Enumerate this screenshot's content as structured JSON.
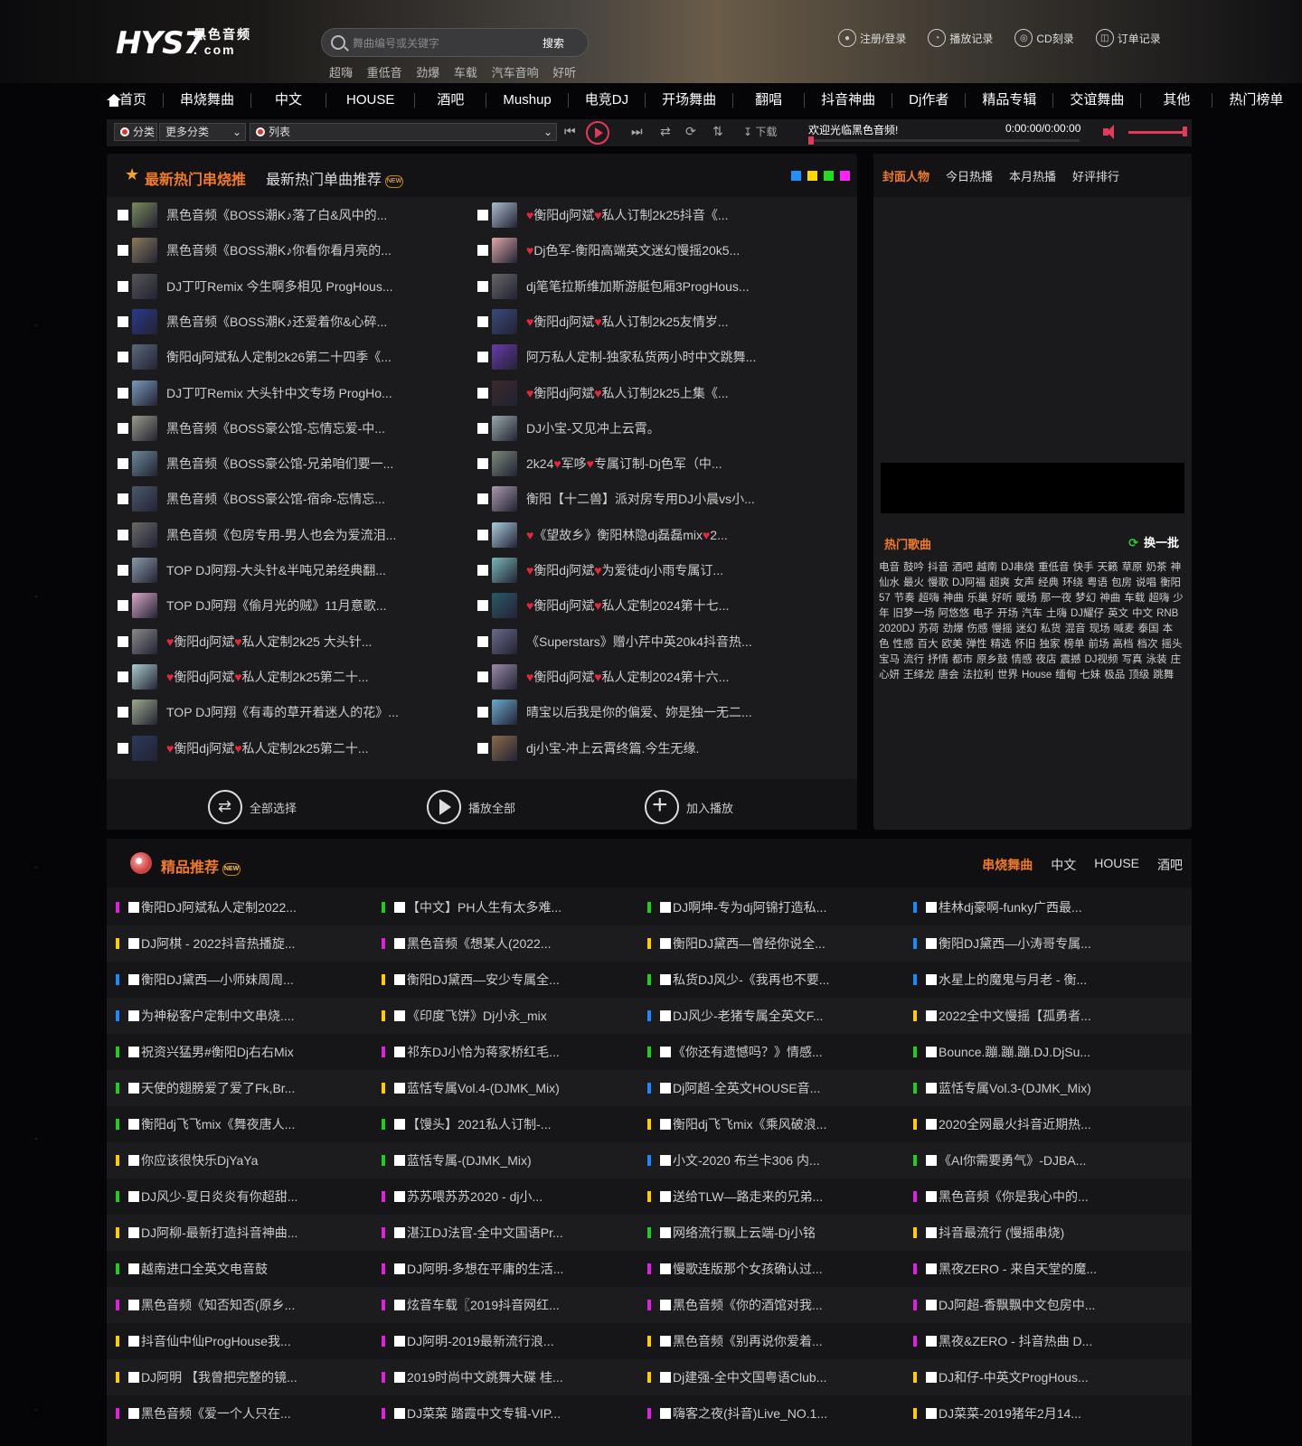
{
  "header": {
    "logo": "HYS7",
    "logo_sub1": "黑色音频",
    "logo_sub2": ". com",
    "search_placeholder": "舞曲编号或关键字",
    "search_button": "搜索",
    "hot_tags": [
      "超嗨",
      "重低音",
      "劲爆",
      "车载",
      "汽车音响",
      "好听"
    ],
    "links": [
      {
        "label": "注册/登录",
        "icon": "user-icon"
      },
      {
        "label": "播放记录",
        "icon": "clock-icon"
      },
      {
        "label": "CD刻录",
        "icon": "disc-icon"
      },
      {
        "label": "订单记录",
        "icon": "order-icon"
      }
    ]
  },
  "nav": {
    "items": [
      "首页",
      "串烧舞曲",
      "中文",
      "HOUSE",
      "酒吧",
      "Mushup",
      "电竞DJ",
      "开场舞曲",
      "翻唱",
      "抖音神曲",
      "Dj作者",
      "精品专辑",
      "交谊舞曲",
      "其他",
      "热门榜单"
    ]
  },
  "player": {
    "category_label": "分类",
    "category_select": "更多分类",
    "list_label": "列表",
    "download": "下载",
    "welcome": "欢迎光临黑色音频!",
    "time": "0:00:00/0:00:00",
    "progress": 0
  },
  "hot": {
    "tab_active": "最新热门串烧推",
    "tab_other": "最新热门单曲推荐",
    "new_badge": "NEW",
    "colors": [
      "#1e90ff",
      "#ffd700",
      "#22dd22",
      "#ff22ff"
    ],
    "left": [
      "黑色音频《BOSS潮K♪落了白&风中的...",
      "黑色音频《BOSS潮K♪你看你看月亮的...",
      "DJ丁叮Remix 今生啊多相见 ProgHous...",
      "黑色音频《BOSS潮K♪还爱着你&心碎...",
      "衡阳dj阿斌私人定制2k26第二十四季《...",
      "DJ丁叮Remix 大头针中文专场 ProgHo...",
      "黑色音频《BOSS豪公馆-忘情忘爱-中...",
      "黑色音频《BOSS豪公馆-兄弟咱们要一...",
      "黑色音频《BOSS豪公馆-宿命-忘情忘...",
      "黑色音频《包房专用-男人也会为爱流泪...",
      "TOP DJ阿翔-大头针&半吨兄弟经典翻...",
      "TOP DJ阿翔《偷月光的贼》11月意歌...",
      "♥衡阳dj阿斌♥私人定制2k25 大头针...",
      "♥衡阳dj阿斌♥私人定制2k25第二十...",
      "TOP DJ阿翔《有毒的草开着迷人的花》...",
      "♥衡阳dj阿斌♥私人定制2k25第二十..."
    ],
    "right": [
      "♥衡阳dj阿斌♥私人订制2k25抖音《...",
      "♥Dj色军-衡阳高端英文迷幻慢摇20k5...",
      "dj笔笔拉斯维加斯游艇包厢3ProgHous...",
      "♥衡阳dj阿斌♥私人订制2k25友情岁...",
      "阿万私人定制-独家私货两小时中文跳舞...",
      "♥衡阳dj阿斌♥私人订制2k25上集《...",
      "DJ小宝-又见冲上云霄。",
      "2k24♥军哆♥专属订制-Dj色军（中...",
      "衡阳【十二兽】派对房专用DJ小晨vs小...",
      "♥《望故乡》衡阳林隐dj磊磊mix♥2...",
      "♥衡阳dj阿斌♥为爱徒dj小雨专属订...",
      "♥衡阳dj阿斌♥私人定制2024第十七...",
      "《Superstars》赠小芹中英20k4抖音热...",
      "♥衡阳dj阿斌♥私人定制2024第十六...",
      "晴宝以后我是你的偏爱、妳是独一无二...",
      "dj小宝-冲上云霄终篇.今生无缘."
    ],
    "footer": [
      "全部选择",
      "播放全部",
      "加入播放"
    ]
  },
  "side": {
    "tabs": [
      "封面人物",
      "今日热播",
      "本月热播",
      "好评排行"
    ],
    "hot_title": "热门歌曲",
    "refresh": "换一批",
    "tags": [
      "电音",
      "鼓吟",
      "抖音",
      "酒吧",
      "越南",
      "DJ串烧",
      "重低音",
      "快手",
      "天籁",
      "草原",
      "奶茶",
      "神仙水",
      "最火",
      "慢歌",
      "DJ阿福",
      "超爽",
      "女声",
      "经典",
      "环绕",
      "粤语",
      "包房",
      "说唱",
      "衡阳57",
      "节奏",
      "超嗨",
      "神曲",
      "乐巢",
      "好听",
      "暖场",
      "那一夜",
      "梦幻",
      "神曲",
      "车载",
      "超嗨",
      "少年",
      "旧梦一场",
      "阿悠悠",
      "电子",
      "开场",
      "汽车",
      "土嗨",
      "DJ耀仔",
      "英文",
      "中文",
      "RNB",
      "2020DJ",
      "苏荷",
      "劲爆",
      "伤感",
      "慢摇",
      "迷幻",
      "私货",
      "混音",
      "现场",
      "喊麦",
      "泰国",
      "本色",
      "性感",
      "百大",
      "欧美",
      "弹性",
      "精选",
      "怀旧",
      "独家",
      "榜单",
      "前场",
      "高档",
      "档次",
      "摇头",
      "宝马",
      "流行",
      "抒情",
      "都市",
      "原乡鼓",
      "情感",
      "夜店",
      "震撼",
      "DJ视频",
      "写真",
      "泳装",
      "庄心妍",
      "王绎龙",
      "唐会",
      "法拉利",
      "世界",
      "House",
      "缅甸",
      "七妹",
      "极品",
      "顶级",
      "跳舞"
    ]
  },
  "featured": {
    "title": "精品推荐",
    "tabs": [
      "串烧舞曲",
      "中文",
      "HOUSE",
      "酒吧"
    ],
    "columns": [
      [
        "衡阳DJ阿斌私人定制2022...",
        "DJ阿棋 - 2022抖音热播旋...",
        "衡阳DJ黛西—小师妹周周...",
        "为神秘客户定制中文串烧....",
        "祝资兴猛男#衡阳Dj右右Mix",
        "天使的翅膀爱了爱了Fk,Br...",
        "衡阳dj飞飞mix《舞夜唐人...",
        "你应该很快乐DjYaYa",
        "DJ风少-夏日炎炎有你超甜...",
        "DJ阿柳-最新打造抖音神曲...",
        "越南进口全英文电音鼓",
        "黑色音频《知否知否(原乡...",
        "抖音仙中仙ProgHouse我...",
        "DJ阿明 【我曾把完整的镜...",
        "黑色音频《爱一个人只在..."
      ],
      [
        "【中文】PH人生有太多难...",
        "黑色音频《想某人(2022...",
        "衡阳DJ黛西—安少专属全...",
        "《印度飞饼》Dj小永_mix",
        "祁东DJ小恰为蒋家桥红毛...",
        "蓝恬专属Vol.4-(DJMK_Mix)",
        "【馒头】2021私人订制-...",
        "蓝恬专属-(DJMK_Mix)",
        "苏苏喂苏苏2020 - dj小...",
        "湛江DJ法官-全中文国语Pr...",
        "DJ阿明-多想在平庸的生活...",
        "炫音车载〖2019抖音网红...",
        "DJ阿明-2019最新流行浪...",
        "2019时尚中文跳舞大碟 桂...",
        "DJ菜菜 踏霞中文专辑-VIP..."
      ],
      [
        "DJ啊坤-专为dj阿锦打造私...",
        "衡阳DJ黛西—曾经你说全...",
        "私货DJ风少-《我再也不要...",
        "DJ风少-老猪专属全英文F...",
        "《你还有遗憾吗？》情感...",
        "Dj阿超-全英文HOUSE音...",
        "衡阳dj飞飞mix《乘风破浪...",
        "小文-2020 布兰卡306 内...",
        "送给TLW—路走来的兄弟...",
        "网络流行飘上云端-Dj小铭",
        "慢歌连版那个女孩确认过...",
        "黑色音频《你的酒馆对我...",
        "黑色音频《别再说你爱着...",
        "Dj建强-全中文国粤语Club...",
        "嗨客之夜(抖音)Live_NO.1..."
      ],
      [
        "桂林dj豪啊-funky广西最...",
        "衡阳DJ黛西—小涛哥专属...",
        "水星上的魔鬼与月老 - 衡...",
        "2022全中文慢摇【孤勇者...",
        "Bounce.蹦.蹦.蹦.DJ.DjSu...",
        "蓝恬专属Vol.3-(DJMK_Mix)",
        "2020全网最火抖音近期热...",
        "《AI你需要勇气》-DJBA...",
        "黑色音频《你是我心中的...",
        "抖音最流行 (慢摇串烧)",
        "黑夜ZERO - 来自天堂的魔...",
        "DJ阿超-香飘飘中文包房中...",
        "黑夜&ZERO - 抖音热曲 D...",
        "DJ和仔-中英文ProgHous...",
        "DJ菜菜-2019猪年2月14..."
      ]
    ],
    "bar_colors": [
      "#dd22dd",
      "#ffcc00",
      "#22cc22",
      "#1e88ff"
    ]
  }
}
